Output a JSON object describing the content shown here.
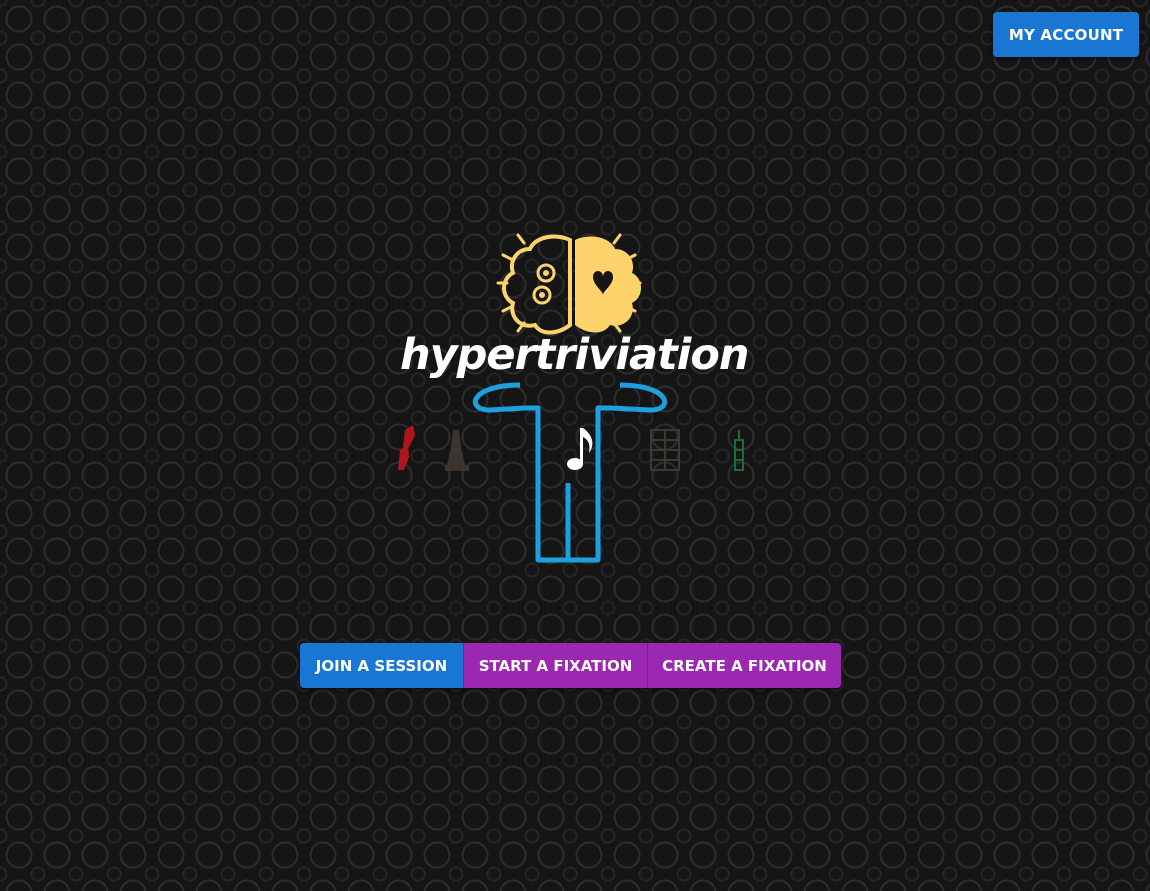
{
  "header": {
    "account_label": "MY ACCOUNT"
  },
  "logo": {
    "title": "hypertriviation",
    "brain_color": "#ffd36b",
    "figure_color": "#1ca0e0"
  },
  "actions": {
    "join_label": "JOIN A SESSION",
    "start_label": "START A FIXATION",
    "create_label": "CREATE A FIXATION",
    "join_color": "#1976d2",
    "fixation_color": "#9c27b0"
  }
}
